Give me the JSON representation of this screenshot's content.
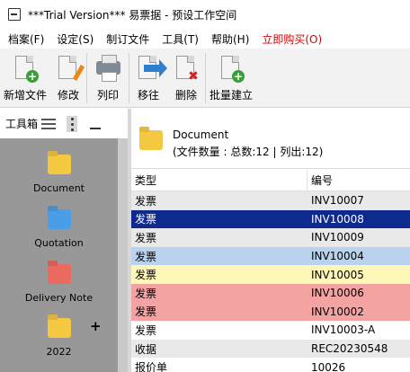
{
  "window": {
    "title": "***Trial Version*** 易票据 - 预设工作空间"
  },
  "menu": [
    {
      "label": "档案(F)",
      "color": ""
    },
    {
      "label": "设定(S)",
      "color": ""
    },
    {
      "label": "制订文件",
      "color": ""
    },
    {
      "label": "工具(T)",
      "color": ""
    },
    {
      "label": "帮助(H)",
      "color": ""
    },
    {
      "label": "立即购买(O)",
      "color": "#d10000"
    }
  ],
  "toolbar": {
    "new_label": "新增文件",
    "edit_label": "修改",
    "print_label": "列印",
    "move_label": "移往",
    "delete_label": "删除",
    "batch_label": "批量建立"
  },
  "sidebar": {
    "title": "工具箱",
    "items": [
      {
        "label": "Document",
        "icon": "folder-icon",
        "color": "#f5c842"
      },
      {
        "label": "Quotation",
        "icon": "folder-icon",
        "color": "#4a9ee8"
      },
      {
        "label": "Delivery Note",
        "icon": "folder-icon",
        "color": "#ea6a60"
      },
      {
        "label": "2022",
        "icon": "folder-icon",
        "color": "#f5c842"
      }
    ]
  },
  "main": {
    "folder_title": "Document",
    "file_count": "(文件数量 : 总数:12 | 列出:12)",
    "columns": [
      "类型",
      "编号"
    ],
    "rows": [
      {
        "type": "发票",
        "number": "INV10007",
        "bg": "#e9e9e9",
        "fg": "#000000"
      },
      {
        "type": "发票",
        "number": "INV10008",
        "bg": "#0f2a8e",
        "fg": "#ffffff"
      },
      {
        "type": "发票",
        "number": "INV10009",
        "bg": "#e9e9e9",
        "fg": "#000000"
      },
      {
        "type": "发票",
        "number": "INV10004",
        "bg": "#b9d3ee",
        "fg": "#000000"
      },
      {
        "type": "发票",
        "number": "INV10005",
        "bg": "#fff7b8",
        "fg": "#000000"
      },
      {
        "type": "发票",
        "number": "INV10006",
        "bg": "#f4a3a3",
        "fg": "#000000"
      },
      {
        "type": "发票",
        "number": "INV10002",
        "bg": "#f4a3a3",
        "fg": "#000000"
      },
      {
        "type": "发票",
        "number": "INV10003-A",
        "bg": "#ffffff",
        "fg": "#000000"
      },
      {
        "type": "收据",
        "number": "REC20230548",
        "bg": "#e9e9e9",
        "fg": "#000000"
      },
      {
        "type": "报价单",
        "number": "10026",
        "bg": "#ffffff",
        "fg": "#000000"
      }
    ]
  }
}
